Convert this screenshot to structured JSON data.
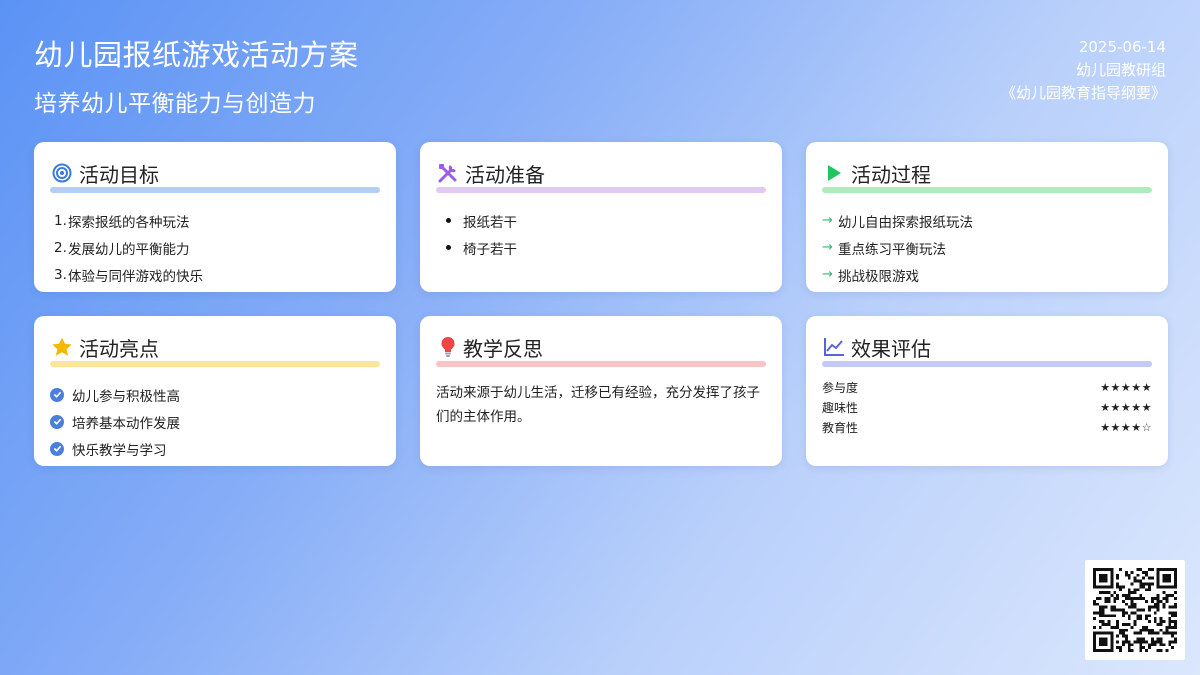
{
  "header": {
    "title": "幼儿园报纸游戏活动方案",
    "subtitle": "培养幼儿平衡能力与创造力"
  },
  "meta": {
    "date": "2025-06-14",
    "author": "幼儿园教研组",
    "reference": "《幼儿园教育指导纲要》"
  },
  "cards": {
    "goals": {
      "icon": "target-icon",
      "title": "活动目标",
      "accent": "#b3cdf5",
      "items": [
        {
          "num": "1.",
          "text": "探索报纸的各种玩法"
        },
        {
          "num": "2.",
          "text": "发展幼儿的平衡能力"
        },
        {
          "num": "3.",
          "text": "体验与同伴游戏的快乐"
        }
      ]
    },
    "prep": {
      "icon": "tools-icon",
      "title": "活动准备",
      "accent": "#e1c8f5",
      "items": [
        "报纸若干",
        "椅子若干"
      ]
    },
    "process": {
      "icon": "play-icon",
      "title": "活动过程",
      "accent": "#b0ebc0",
      "arrow": "→",
      "items": [
        "幼儿自由探索报纸玩法",
        "重点练习平衡玩法",
        "挑战极限游戏"
      ]
    },
    "highlights": {
      "icon": "star-icon",
      "title": "活动亮点",
      "accent": "#fce59a",
      "items": [
        "幼儿参与积极性高",
        "培养基本动作发展",
        "快乐教学与学习"
      ]
    },
    "reflection": {
      "icon": "lightbulb-icon",
      "title": "教学反思",
      "accent": "#f7c5c5",
      "text": "活动来源于幼儿生活，迁移已有经验，充分发挥了孩子们的主体作用。"
    },
    "evaluation": {
      "icon": "chart-icon",
      "title": "效果评估",
      "accent": "#c5c9f5",
      "rows": [
        {
          "label": "参与度",
          "stars": "★★★★★"
        },
        {
          "label": "趣味性",
          "stars": "★★★★★"
        },
        {
          "label": "教育性",
          "stars": "★★★★☆"
        }
      ]
    }
  },
  "qr": {
    "icon": "qr-code-icon"
  }
}
